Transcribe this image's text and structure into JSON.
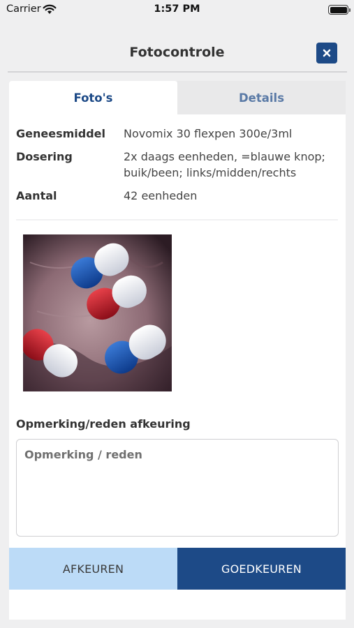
{
  "status_bar": {
    "carrier": "Carrier",
    "time": "1:57 PM",
    "icons": [
      "wifi-icon",
      "battery-icon"
    ]
  },
  "header": {
    "title": "Fotocontrole",
    "close_icon": "close-icon",
    "close_symbol": "×"
  },
  "tabs": [
    {
      "label": "Foto's",
      "active": true
    },
    {
      "label": "Details",
      "active": false
    }
  ],
  "details": [
    {
      "label": "Geneesmiddel",
      "value": "Novomix 30 flexpen 300e/3ml"
    },
    {
      "label": "Dosering",
      "value": "2x daags eenheden, =blauwe knop; buik/been; links/midden/rechts"
    },
    {
      "label": "Aantal",
      "value": "42 eenheden"
    }
  ],
  "remark": {
    "label": "Opmerking/reden afkeuring",
    "placeholder": "Opmerking / reden",
    "value": ""
  },
  "buttons": {
    "reject": "AFKEUREN",
    "approve": "GOEDKEUREN"
  },
  "colors": {
    "primary": "#1d4a87",
    "reject_bg": "#bcdbf7",
    "page_bg": "#efeff0"
  }
}
